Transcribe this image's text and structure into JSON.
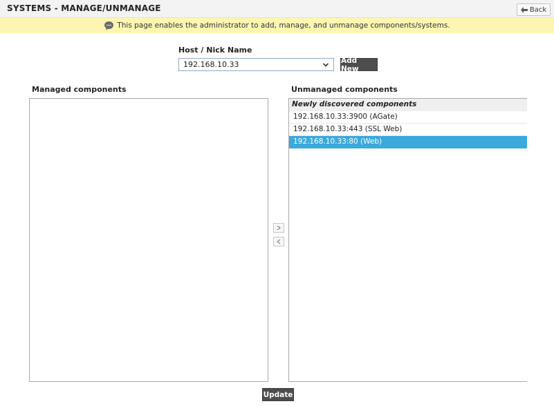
{
  "header": {
    "title": "SYSTEMS - MANAGE/UNMANAGE",
    "back_label": "Back"
  },
  "info": {
    "message": "This page enables the administrator to add, manage, and unmanage components/systems."
  },
  "host": {
    "label": "Host / Nick Name",
    "selected_value": "192.168.10.33",
    "add_new_label": "Add New"
  },
  "managed": {
    "label": "Managed components",
    "items": []
  },
  "unmanaged": {
    "label": "Unmanaged components",
    "group_label": "Newly discovered components",
    "items": [
      {
        "label": "192.168.10.33:3900 (AGate)",
        "selected": false
      },
      {
        "label": "192.168.10.33:443 (SSL Web)",
        "selected": false
      },
      {
        "label": "192.168.10.33:80 (Web)",
        "selected": true
      }
    ]
  },
  "actions": {
    "update_label": "Update"
  },
  "colors": {
    "selection": "#3aa9dc",
    "info_banner": "#fdf6b2",
    "dark_button": "#4d4d4d"
  }
}
